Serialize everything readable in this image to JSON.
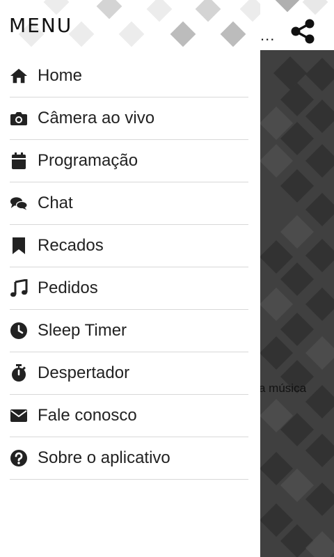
{
  "drawer": {
    "title": "MENU",
    "items": [
      {
        "label": "Home",
        "icon": "home-icon"
      },
      {
        "label": "Câmera ao vivo",
        "icon": "camera-icon"
      },
      {
        "label": "Programação",
        "icon": "calendar-icon"
      },
      {
        "label": "Chat",
        "icon": "chat-icon"
      },
      {
        "label": "Recados",
        "icon": "bookmark-icon"
      },
      {
        "label": "Pedidos",
        "icon": "music-note-icon"
      },
      {
        "label": "Sleep Timer",
        "icon": "clock-icon"
      },
      {
        "label": "Despertador",
        "icon": "stopwatch-icon"
      },
      {
        "label": "Fale conosco",
        "icon": "envelope-icon"
      },
      {
        "label": "Sobre o aplicativo",
        "icon": "help-circle-icon"
      }
    ]
  },
  "background": {
    "header_ellipsis": "...",
    "share_icon": "share-icon",
    "partial_text": "a música"
  },
  "colors": {
    "drawer_bg": "#ffffff",
    "icon_color": "#222222",
    "divider": "#d8d8d8",
    "app_bg": "#404040"
  }
}
